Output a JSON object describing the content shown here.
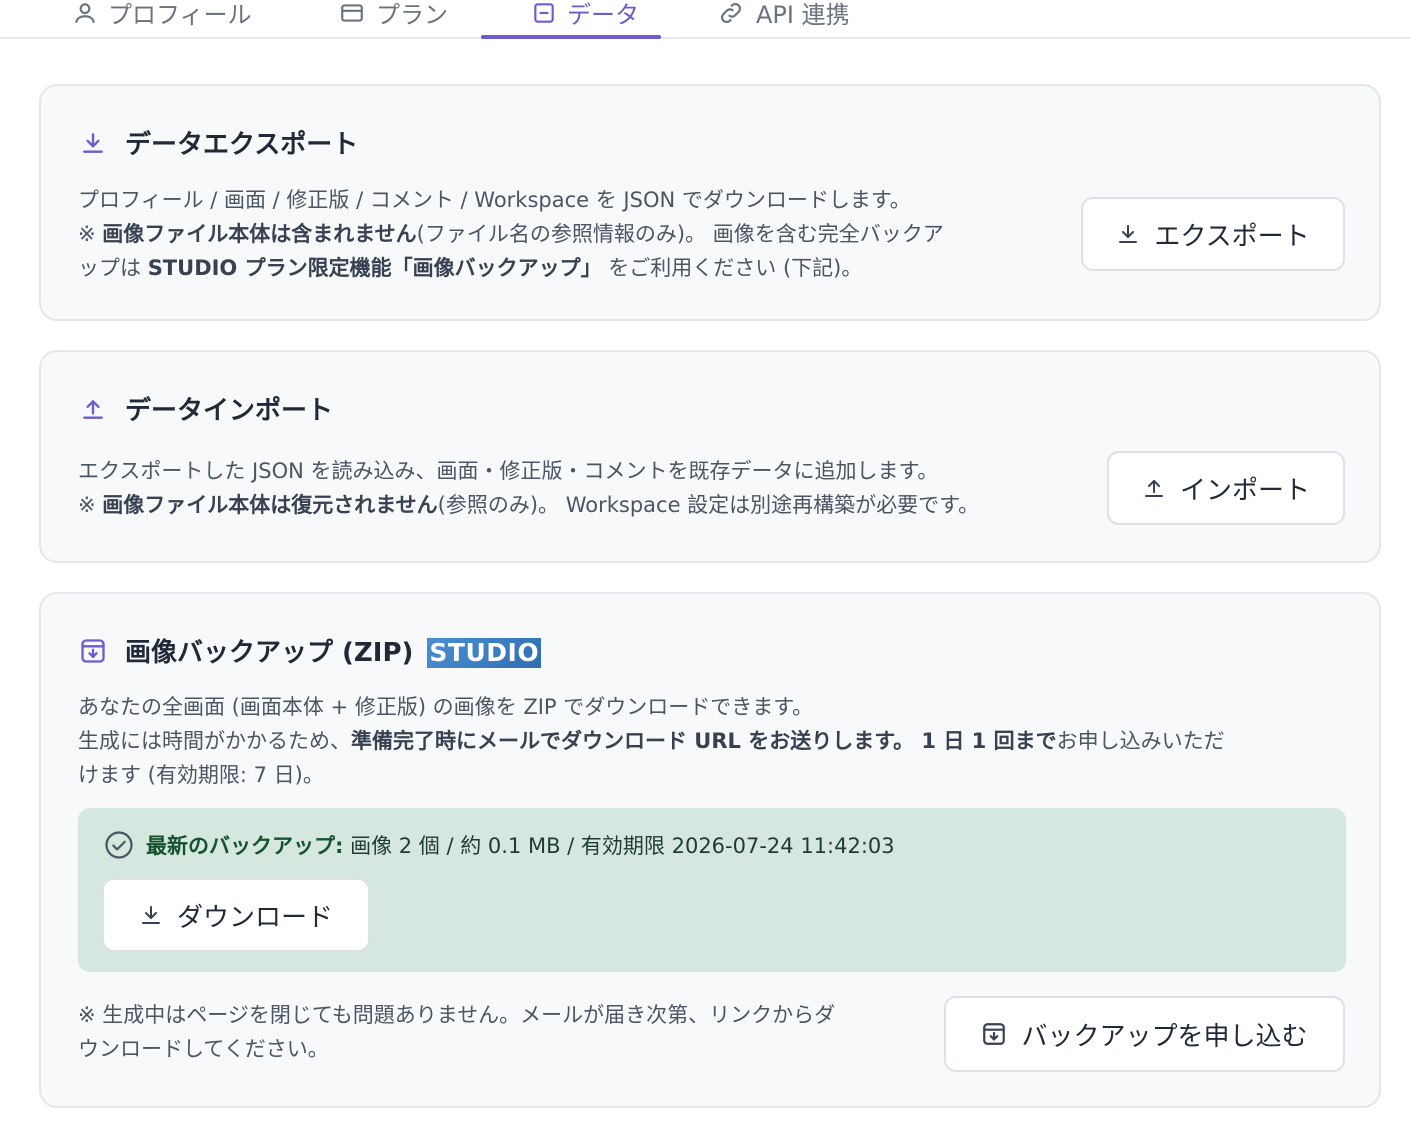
{
  "tabs": [
    {
      "label": "プロフィール",
      "icon": "user-icon",
      "active": false
    },
    {
      "label": "プラン",
      "icon": "card-icon",
      "active": false
    },
    {
      "label": "データ",
      "icon": "data-icon",
      "active": true
    },
    {
      "label": "API 連携",
      "icon": "link-icon",
      "active": false
    }
  ],
  "export": {
    "title": "データエクスポート",
    "line1": "プロフィール / 画面 / 修正版 / コメント / Workspace を JSON でダウンロードします。",
    "line2_prefix": "※ ",
    "line2_bold": "画像ファイル本体は含まれません",
    "line2_rest": "(ファイル名の参照情報のみ)。 画像を含む完全バックア",
    "line3_prefix": "ップは ",
    "line3_bold": "STUDIO プラン限定機能「画像バックアップ」",
    "line3_rest": " をご利用ください (下記)。",
    "button_label": "エクスポート"
  },
  "import": {
    "title": "データインポート",
    "line1": "エクスポートした JSON を読み込み、画面・修正版・コメントを既存データに追加します。",
    "line2_prefix": "※ ",
    "line2_bold": "画像ファイル本体は復元されません",
    "line2_rest": "(参照のみ)。 Workspace 設定は別途再構築が必要です。",
    "button_label": "インポート"
  },
  "backup": {
    "title": "画像バックアップ (ZIP)",
    "badge": "STUDIO",
    "line1": "あなたの全画面 (画面本体 + 修正版) の画像を ZIP でダウンロードできます。",
    "line2_prefix": "生成には時間がかかるため、",
    "line2_bold1": "準備完了時にメールでダウンロード URL をお送りします。 1 日 1 回まで",
    "line2_rest": "お申し込みいただ",
    "line3": "けます (有効期限: 7 日)。",
    "latest_label": "最新のバックアップ:",
    "latest_info": "画像 2 個 / 約 0.1 MB / 有効期限 2026-07-24 11:42:03",
    "download_label": "ダウンロード",
    "note_line1": "※ 生成中はページを閉じても問題ありません。メールが届き次第、リンクからダ",
    "note_line2": "ウンロードしてください。",
    "request_label": "バックアップを申し込む"
  },
  "colors": {
    "accent": "#6d5bd0",
    "success_bg": "#d5e7df",
    "success_text": "#14532d",
    "badge": "#3a7dc2"
  }
}
